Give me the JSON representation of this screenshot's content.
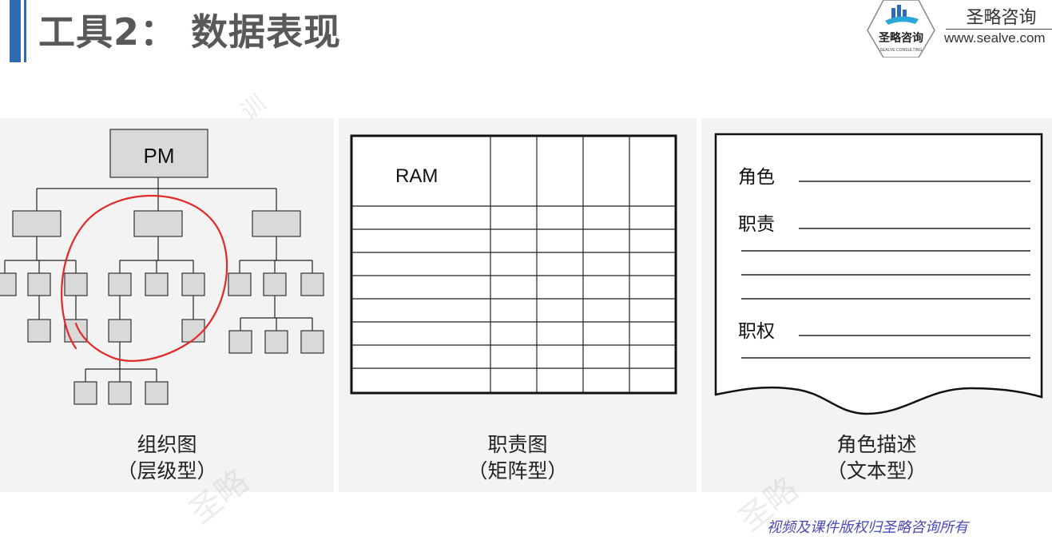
{
  "header": {
    "title": "工具2： 数据表现",
    "brand_name": "圣略咨询",
    "brand_url": "www.sealve.com",
    "logo_text": "圣略咨询",
    "logo_subtext": "SEALVE CONSULTING"
  },
  "org_chart": {
    "root_label": "PM",
    "caption_line1": "组织图",
    "caption_line2": "（层级型）"
  },
  "ram_chart": {
    "corner_label": "RAM",
    "caption_line1": "职责图",
    "caption_line2": "（矩阵型）"
  },
  "role_text": {
    "field_role": "角色",
    "field_responsibility": "职责",
    "field_authority": "职权",
    "caption_line1": "角色描述",
    "caption_line2": "（文本型）"
  },
  "footer": {
    "note": "视频及课件版权归圣略咨询所有"
  },
  "colors": {
    "accent_blue": "#2f6bb3",
    "box_gray": "#d9d9d9",
    "annotation_red": "#e02a2a"
  }
}
